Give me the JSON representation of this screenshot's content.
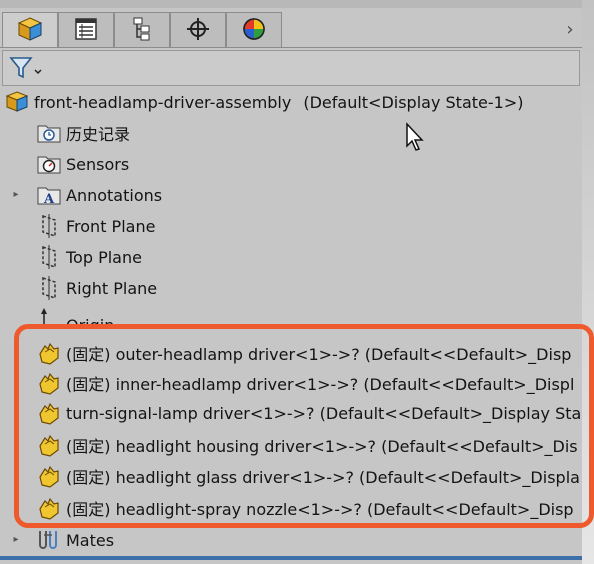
{
  "tabs": [
    {
      "name": "feature-manager-tab",
      "icon": "assembly-cube-icon",
      "active": true
    },
    {
      "name": "property-manager-tab",
      "icon": "property-list-icon",
      "active": false
    },
    {
      "name": "configuration-manager-tab",
      "icon": "configuration-tree-icon",
      "active": false
    },
    {
      "name": "dimxpert-manager-tab",
      "icon": "crosshair-icon",
      "active": false
    },
    {
      "name": "display-manager-tab",
      "icon": "appearance-sphere-icon",
      "active": false
    }
  ],
  "tab_scroll_glyph": "›",
  "filter": {
    "icon": "filter-funnel-icon"
  },
  "tree": {
    "root": {
      "label": "front-headlamp-driver-assembly",
      "config": "(Default<Display State-1>)"
    },
    "items": [
      {
        "label": "历史记录",
        "icon": "history-icon"
      },
      {
        "label": "Sensors",
        "icon": "sensor-icon"
      },
      {
        "label": "Annotations",
        "icon": "annotations-icon",
        "expandable": true
      },
      {
        "label": "Front Plane",
        "icon": "plane-icon"
      },
      {
        "label": "Top Plane",
        "icon": "plane-icon"
      },
      {
        "label": "Right Plane",
        "icon": "plane-icon"
      },
      {
        "label": "Origin",
        "icon": "origin-icon"
      }
    ],
    "components": [
      {
        "text": "(固定) outer-headlamp driver<1>->? (Default<<Default>_Disp"
      },
      {
        "text": "(固定) inner-headlamp driver<1>->? (Default<<Default>_Displ"
      },
      {
        "text": "turn-signal-lamp driver<1>->? (Default<<Default>_Display Sta"
      },
      {
        "text": "(固定) headlight housing driver<1>->? (Default<<Default>_Dis"
      },
      {
        "text": "(固定) headlight glass driver<1>->? (Default<<Default>_Displa"
      },
      {
        "text": "(固定) headlight-spray nozzle<1>->? (Default<<Default>_Disp"
      }
    ],
    "mates": {
      "label": "Mates",
      "icon": "mates-icon",
      "expandable": true
    }
  },
  "colors": {
    "highlight": "#ee5a2e",
    "panel": "#c6c6c6",
    "selection_line": "#3d6fa9"
  }
}
